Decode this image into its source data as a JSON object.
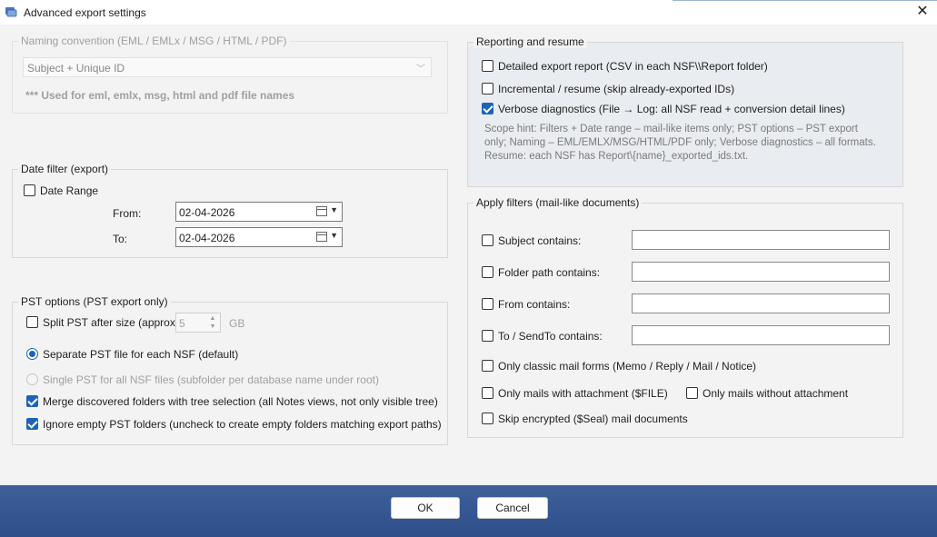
{
  "window": {
    "title": "Advanced export settings",
    "close_glyph": "✕",
    "app_icon": "export-settings-icon"
  },
  "naming": {
    "legend": "Naming convention (EML / EMLx / MSG / HTML / PDF)",
    "selected": "Subject + Unique ID",
    "note": "*** Used for eml, emlx, msg, html and pdf file names"
  },
  "date_filter": {
    "legend": "Date filter (export)",
    "date_range_label": "Date Range",
    "date_range_checked": false,
    "from_label": "From:",
    "from_value": "02-04-2026",
    "to_label": "To:",
    "to_value": "02-04-2026"
  },
  "pst": {
    "legend": "PST options (PST export only)",
    "split_label": "Split PST after size (approx.)",
    "split_checked": false,
    "split_value": "5",
    "split_unit": "GB",
    "separate_label": "Separate PST file for each NSF (default)",
    "separate_selected": true,
    "single_label": "Single PST for all NSF files (subfolder per database name under root)",
    "single_selected": false,
    "merge_label": "Merge discovered folders with tree selection (all Notes views, not only visible tree)",
    "merge_checked": true,
    "ignore_label": "Ignore empty PST folders (uncheck to create empty folders matching export paths)",
    "ignore_checked": true
  },
  "reporting": {
    "legend": "Reporting and resume",
    "detailed_label": "Detailed export report (CSV in each NSF\\\\Report folder)",
    "detailed_checked": false,
    "incremental_label": "Incremental / resume (skip already-exported IDs)",
    "incremental_checked": false,
    "verbose_label": "Verbose diagnostics (File → Log: all NSF read + conversion detail lines)",
    "verbose_checked": true,
    "hint_line1": "Scope hint: Filters + Date range – mail-like items only; PST options – PST export",
    "hint_line2": "only; Naming – EML/EMLX/MSG/HTML/PDF only; Verbose diagnostics – all formats.",
    "hint_line3": "Resume: each NSF has Report\\{name}_exported_ids.txt."
  },
  "filters": {
    "legend": "Apply filters (mail-like documents)",
    "subject_label": "Subject contains:",
    "subject_value": "",
    "folder_label": "Folder path contains:",
    "folder_value": "",
    "from_label": "From contains:",
    "from_value": "",
    "to_label": "To / SendTo contains:",
    "to_value": "",
    "classic_label": "Only classic mail forms (Memo / Reply / Mail / Notice)",
    "with_attach_label": "Only mails with attachment ($FILE)",
    "without_attach_label": "Only mails without attachment",
    "skip_encrypted_label": "Skip encrypted ($Seal) mail documents"
  },
  "footer": {
    "ok_label": "OK",
    "cancel_label": "Cancel"
  },
  "colors": {
    "accent": "#1d63b8",
    "footer": "#34558f"
  }
}
